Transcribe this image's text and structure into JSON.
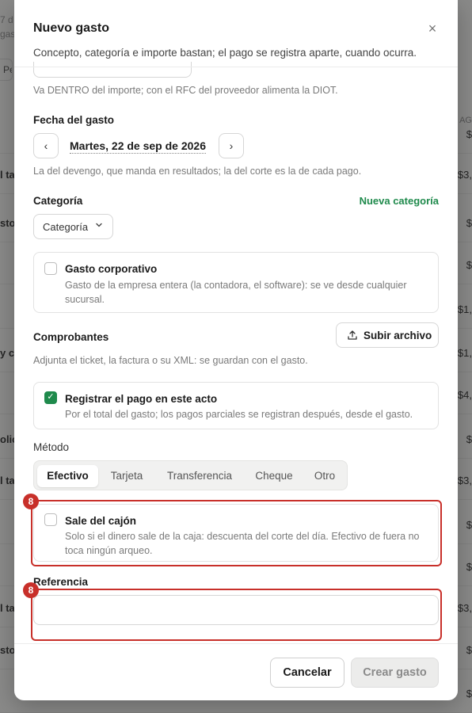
{
  "background": {
    "top_left_fragment_1": "7 d",
    "top_left_fragment_2": "gas",
    "filter_fragment": "Pe",
    "column_fragment": "AG",
    "rows": [
      {
        "left": "",
        "right": "$"
      },
      {
        "left": "l ta",
        "right": "$3,"
      },
      {
        "left": "stop",
        "right": "$"
      },
      {
        "left": "",
        "right": "$"
      },
      {
        "left": "",
        "right": "$1,"
      },
      {
        "left": "y c",
        "right": "$1,"
      },
      {
        "left": "",
        "right": "$4,"
      },
      {
        "left": "olic",
        "right": "$"
      },
      {
        "left": "l ta",
        "right": "$3,"
      },
      {
        "left": "",
        "right": "$"
      },
      {
        "left": "",
        "right": "$"
      },
      {
        "left": "l ta",
        "right": "$3,"
      },
      {
        "left": "stop",
        "right": "$"
      },
      {
        "left": "",
        "right": "$"
      }
    ]
  },
  "modal": {
    "title": "Nuevo gasto",
    "close_label": "×",
    "subtitle": "Concepto, categoría e importe bastan; el pago se registra aparte, cuando ocurra.",
    "tax_hint": "Va DENTRO del importe; con el RFC del proveedor alimenta la DIOT.",
    "date": {
      "label": "Fecha del gasto",
      "prev": "‹",
      "next": "›",
      "value": "Martes, 22 de sep de 2026",
      "hint": "La del devengo, que manda en resultados; la del corte es la de cada pago."
    },
    "category": {
      "label": "Categoría",
      "new_link": "Nueva categoría",
      "select_value": "Categoría"
    },
    "corporate": {
      "title": "Gasto corporativo",
      "description": "Gasto de la empresa entera (la contadora, el software): se ve desde cualquier sucursal.",
      "checked": false
    },
    "receipts": {
      "label": "Comprobantes",
      "upload_button": "Subir archivo",
      "hint": "Adjunta el ticket, la factura o su XML: se guardan con el gasto."
    },
    "register_payment": {
      "title": "Registrar el pago en este acto",
      "description": "Por el total del gasto; los pagos parciales se registran después, desde el gasto.",
      "checked": true
    },
    "method": {
      "label": "Método",
      "options": [
        "Efectivo",
        "Tarjeta",
        "Transferencia",
        "Cheque",
        "Otro"
      ],
      "selected": "Efectivo"
    },
    "cash_drawer": {
      "title": "Sale del cajón",
      "description": "Solo si el dinero sale de la caja: descuenta del corte del día. Efectivo de fuera no toca ningún arqueo.",
      "checked": false
    },
    "reference": {
      "label": "Referencia",
      "value": ""
    },
    "footer": {
      "cancel": "Cancelar",
      "create": "Crear gasto"
    }
  },
  "annotations": {
    "badge_1": "8",
    "badge_2": "8",
    "color": "#c8302a"
  },
  "colors": {
    "accent_green": "#1f8a4c",
    "highlight_red": "#c8302a"
  }
}
